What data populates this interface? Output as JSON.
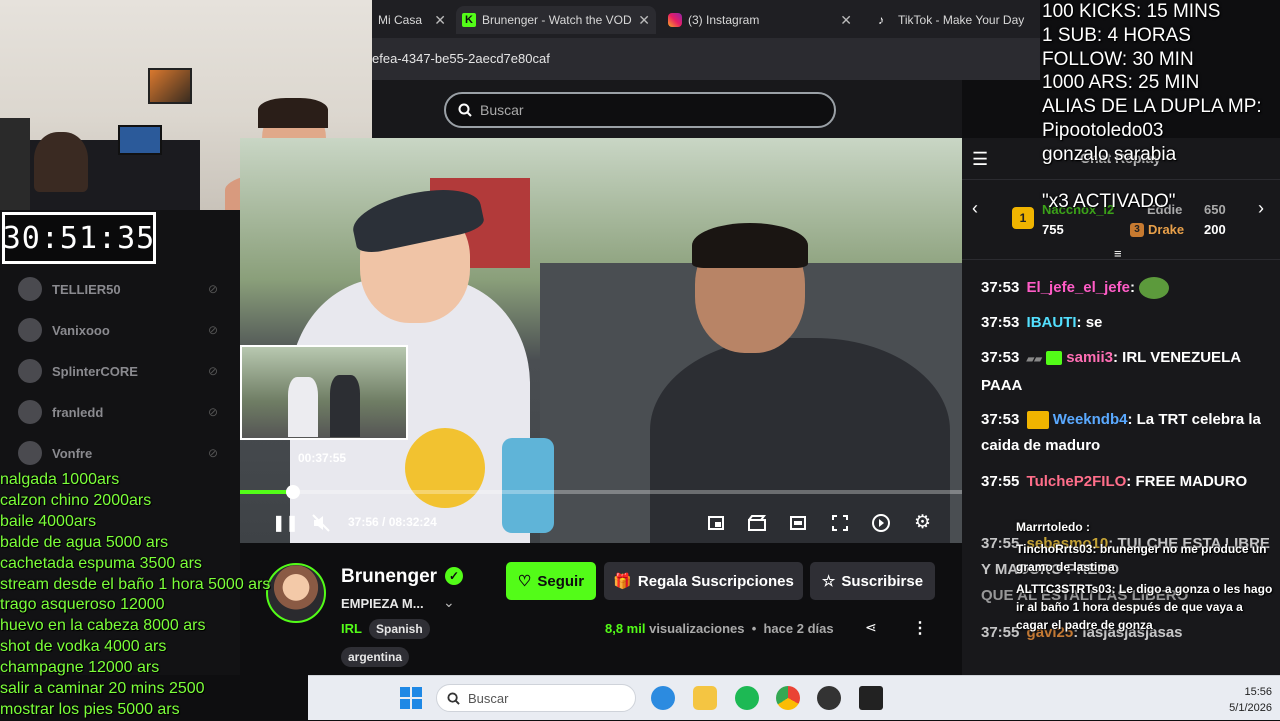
{
  "browser": {
    "tabs": [
      {
        "label": "Mi Casa",
        "icon": "tab-icon"
      },
      {
        "label": "Brunenger - Watch the VOD",
        "icon": "kick-logo-icon"
      },
      {
        "label": "(3) Instagram",
        "icon": "instagram-icon"
      },
      {
        "label": "TikTok - Make Your Day",
        "icon": "tiktok-icon"
      }
    ],
    "url": "efea-4347-be55-2aecd7e80caf"
  },
  "site": {
    "search_placeholder": "Buscar"
  },
  "overlay": {
    "timer": "30:51:35",
    "goals": [
      "100 KICKS: 15 MINS",
      "1 SUB: 4 HORAS",
      "FOLLOW: 30 MIN",
      "1000 ARS: 25 MIN",
      "ALIAS DE LA DUPLA MP:",
      "Pipootoledo03",
      "gonzalo sarabia",
      "",
      "\"x3 ACTIVADO\""
    ],
    "prices": [
      "nalgada 1000ars",
      "calzon chino 2000ars",
      "baile 4000ars",
      "balde de agua 5000 ars",
      "cachetada espuma 3500 ars",
      "stream desde el baño 1 hora 5000 ars",
      "trago asqueroso 12000",
      "huevo en la cabeza 8000 ars",
      "shot de vodka 4000 ars",
      "champagne 12000 ars",
      "salir a caminar 20 mins 2500",
      "mostrar los pies 5000 ars"
    ],
    "alerts": [
      {
        "user": "Marrrtoledo",
        "text": ""
      },
      {
        "user": "TinchoRrts03",
        "text": "brunenger no me produce un gramo de lastima"
      },
      {
        "user": "ALTTC3STRTs03",
        "text": "Le digo a gonza o les hago ir al baño 1 hora después de que vaya a cagar el padre de gonza"
      }
    ]
  },
  "sidebar": {
    "channels": [
      "TELLIER50",
      "Vanixooo",
      "SplinterCORE",
      "franledd",
      "Vonfre"
    ]
  },
  "player": {
    "pip_time": "00:37:55",
    "current_time": "37:56",
    "duration": "08:32:24",
    "progress": 0.074
  },
  "channel": {
    "name": "Brunenger",
    "title": "EMPIEZA M...",
    "category": "IRL",
    "tags": [
      "Spanish",
      "argentina"
    ],
    "follow_label": "Seguir",
    "gift_label": "Regala Suscripciones",
    "subscribe_label": "Suscribirse",
    "views_count": "8,8 mil",
    "views_label": "visualizaciones",
    "ago": "hace 2 días"
  },
  "chat": {
    "header": "Chat Replay",
    "leaderboard": [
      {
        "rank": "1",
        "name": "Nacchox_l2",
        "points": "755"
      },
      {
        "rank": "",
        "name": "Eddie",
        "points": "650"
      },
      {
        "rank": "3",
        "name": "Drake",
        "points": "200"
      }
    ],
    "messages": [
      {
        "ts": "37:53",
        "user": "El_jefe_el_jefe",
        "color": "#ff5cc7",
        "text": ""
      },
      {
        "ts": "37:53",
        "user": "IBAUTI",
        "color": "#53e0ff",
        "text": "se"
      },
      {
        "ts": "37:53",
        "user": "samii3",
        "color": "#ff6eb4",
        "text": "IRL VENEZUELA PAAA"
      },
      {
        "ts": "37:53",
        "user": "Weekndb4",
        "color": "#5aa9ff",
        "text": "La TRT celebra la caida de maduro"
      },
      {
        "ts": "37:55",
        "user": "TulcheP2FILO",
        "color": "#ff6e8a",
        "text": "FREE MADURO"
      },
      {
        "ts": "37:55",
        "user": "sebasmo10",
        "color": "#ffd23f",
        "text": "TULCHE ESTA LIBRE Y MADURO PRESO"
      },
      {
        "ts": "37:55",
        "user": "",
        "color": "#fff",
        "text": "QUE AL ESTALI LAS LIBERO"
      },
      {
        "ts": "37:55",
        "user": "gavi25",
        "color": "#ff9b3d",
        "text": "lasjasjasjasas"
      }
    ]
  },
  "taskbar": {
    "search_label": "Buscar",
    "time": "15:56",
    "date": "5/1/2026"
  }
}
